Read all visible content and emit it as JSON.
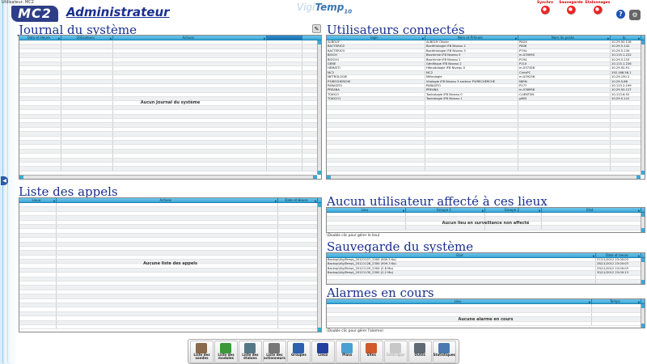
{
  "window_title": "Utilisateur: MC2",
  "logo": "MC2",
  "page_title": "Administrateur",
  "product": {
    "main": "Vigi",
    "bold": "Temp",
    "sub": "10"
  },
  "top_buttons": [
    {
      "label": "Synchro"
    },
    {
      "label": "Sauvegarde"
    },
    {
      "label": "Etalonnages"
    }
  ],
  "help_label": "?",
  "journal": {
    "title": "Journal du système",
    "columns": [
      "Date et Heure",
      "Utilisateurs",
      "Actions"
    ],
    "empty": "Aucun Journal du système"
  },
  "appels": {
    "title": "Liste des appels",
    "columns": [
      "Lieux",
      "Actions",
      "Date et Heure"
    ],
    "empty": "Aucune liste des appels"
  },
  "connectes": {
    "title": "Utilisateurs connectés",
    "columns": [
      "login",
      "Nom et Prénom",
      "Nom du poste",
      "Ip"
    ],
    "rows": [
      [
        "ALBOUY",
        "ALBOUY Olivier",
        "PAGX",
        "10.29.50.118"
      ],
      [
        "BACTERIO2",
        "Bactériologie IFB Niveau 2",
        "P806",
        "10.29.5.142"
      ],
      [
        "BACTERIO3",
        "Bactériologie IFB Niveau 3",
        "P794",
        "10.29.5.130"
      ],
      [
        "BIOCH",
        "Biochimie IFB Niveau 0",
        "m-039090",
        "10.115.1.222"
      ],
      [
        "BIOCH1",
        "Biochimie IFB Niveau 1",
        "P194",
        "10.29.5.133"
      ],
      [
        "GENE",
        "Génétique IFB Niveau 2",
        "P110",
        "10.115.1.226"
      ],
      [
        "HEMATO",
        "Hématologie IFB Niveau 0",
        "m-037458",
        "10.29.50.91"
      ],
      [
        "MC2",
        "MC2",
        "ChrisPC",
        "192.168.56.1"
      ],
      [
        "METROLOGIE",
        "Métrologie",
        "m-039238",
        "10.29.150.2"
      ],
      [
        "P3/RECHERCHE",
        "Virologie IFB Niveau 3 secteur P3/RECHERCHE",
        "MJRN",
        "10.29.5.86"
      ],
      [
        "PARASITO",
        "PARASITO",
        "P177",
        "10.113.2.199"
      ],
      [
        "PREANA",
        "PREANA",
        "m-038998",
        "10.29.50.127"
      ],
      [
        "TOXICO",
        "Toxicologie IFB Niveau 0",
        "CLIENTSN",
        "10.113.6.52"
      ],
      [
        "TOXICO1",
        "Toxicologie IFB Niveau 1",
        "p805",
        "10.29.5.141"
      ]
    ]
  },
  "affecte": {
    "title": "Aucun utilisateur affecté à ces lieux",
    "columns": [
      "Lieu",
      "Groupe 1",
      "Groupe 2",
      "Etat"
    ],
    "empty": "Aucun lieu en surveillance non affecté",
    "note": "(Double clic pour gérer le lieu)"
  },
  "sauvegarde": {
    "title": "Sauvegarde du système",
    "columns": [
      "Etat",
      "Date et heure"
    ],
    "rows": [
      [
        "Backup\\VigiTemp\\_20121127_2300 (900.5 Ko)",
        "27/11/2012 23:00:03"
      ],
      [
        "Backup\\VigiTemp\\_20121128_2300 (909.3 Ko)",
        "28/11/2012 23:00:03"
      ],
      [
        "Backup\\VigiTemp\\_20121129_2300 (2.8 Mo)",
        "29/11/2012 23:00:03"
      ],
      [
        "Backup\\VigiTemp\\_20121130_2300 (2.2 Mo)",
        "30/11/2012 23:00:13"
      ]
    ]
  },
  "alarmes": {
    "title": "Alarmes en cours",
    "columns": [
      "Lieu",
      "Temps"
    ],
    "empty": "Aucune alarme en cours",
    "note": "(Double clic pour gérer l'alarme)"
  },
  "toolbar": [
    {
      "name": "liste-sondes",
      "label": "Liste des sondes",
      "color": "#8a6a4a"
    },
    {
      "name": "liste-modules",
      "label": "Liste des modules",
      "color": "#3a9a3a"
    },
    {
      "name": "liste-etalons",
      "label": "Liste des étalons",
      "color": "#557788"
    },
    {
      "name": "liste-actionneurs",
      "label": "Liste des actionneurs",
      "color": "#777777"
    },
    {
      "name": "groupes",
      "label": "Groupes",
      "color": "#2f5fb0"
    },
    {
      "name": "lieux",
      "label": "Lieux",
      "color": "#2340a0"
    },
    {
      "name": "plans",
      "label": "Plans",
      "color": "#4aa0d0"
    },
    {
      "name": "sites",
      "label": "Sites",
      "color": "#d05a2a"
    },
    {
      "name": "datalogger",
      "label": "DataLogger",
      "color": "#c8c8c8",
      "disabled": true
    },
    {
      "name": "outils",
      "label": "Outils",
      "color": "#606a74"
    },
    {
      "name": "statistiques",
      "label": "Statistiques",
      "color": "#4a7ab0"
    }
  ]
}
